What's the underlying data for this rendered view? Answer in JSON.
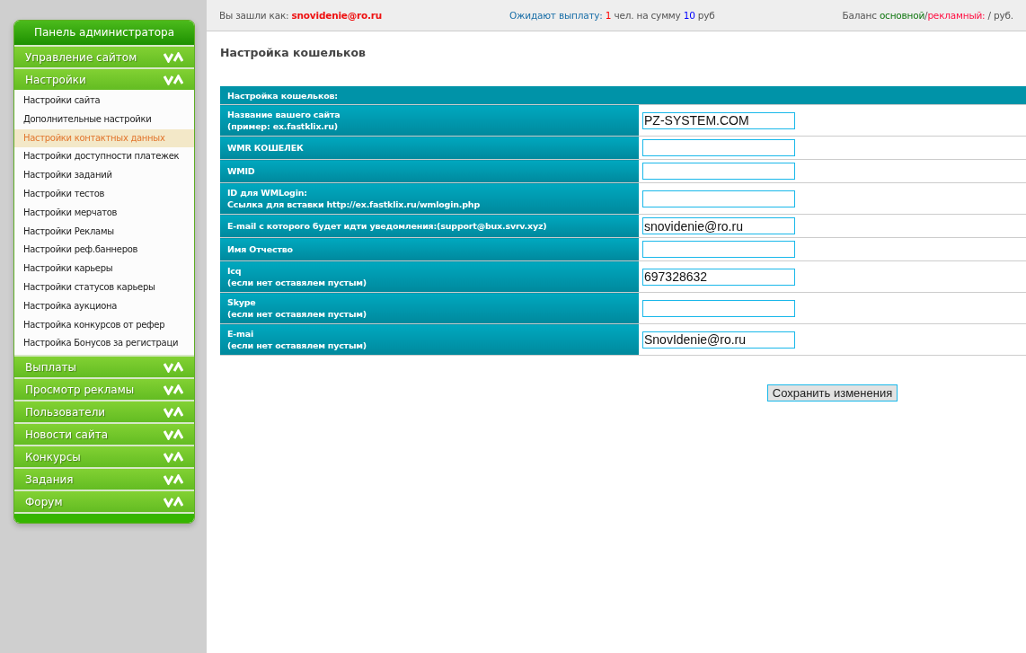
{
  "top_bar": {
    "login": {
      "label": "Вы зашли как:",
      "user": "snovidenie@ro.ru"
    },
    "pending": {
      "label": "Ожидают выплату:",
      "count": "1",
      "middle": "чел. на сумму",
      "sum": "10",
      "unit": "руб"
    },
    "balance": {
      "label": "Баланс",
      "main": "основной",
      "sep": "/",
      "ads": "рекламный:",
      "tail": "/ руб."
    }
  },
  "sidebar": {
    "title": "Панель администратора",
    "sections": [
      {
        "label": "Управление сайтом"
      },
      {
        "label": "Настройки",
        "items": [
          {
            "label": "Настройки сайта",
            "selected": false
          },
          {
            "label": "Дополнительные настройки",
            "selected": false
          },
          {
            "label": "Настройки контактных данных",
            "selected": true
          },
          {
            "label": "Настройки доступности платежек",
            "selected": false
          },
          {
            "label": "Настройки заданий",
            "selected": false
          },
          {
            "label": "Настройки тестов",
            "selected": false
          },
          {
            "label": "Настройки мерчатов",
            "selected": false
          },
          {
            "label": "Настройки Рекламы",
            "selected": false
          },
          {
            "label": "Настройки реф.баннеров",
            "selected": false
          },
          {
            "label": "Настройки карьеры",
            "selected": false
          },
          {
            "label": "Настройки статусов карьеры",
            "selected": false
          },
          {
            "label": "Настройка аукциона",
            "selected": false
          },
          {
            "label": "Настройка конкурсов от рефер",
            "selected": false
          },
          {
            "label": "Настройка Бонусов за регистраци",
            "selected": false
          }
        ]
      },
      {
        "label": "Выплаты"
      },
      {
        "label": "Просмотр рекламы"
      },
      {
        "label": "Пользователи"
      },
      {
        "label": "Новости сайта"
      },
      {
        "label": "Конкурсы"
      },
      {
        "label": "Задания"
      },
      {
        "label": "Форум"
      }
    ]
  },
  "page_title": "Настройка кошельков",
  "form": {
    "header": "Настройка кошельков:",
    "rows": [
      {
        "lines": [
          "Название вашего сайта",
          "(пример: ex.fastklix.ru)"
        ],
        "value": "PZ-SYSTEM.COM"
      },
      {
        "lines": [
          "WMR КОШЕЛЕК"
        ]
      },
      {
        "lines": [
          "WMID"
        ]
      },
      {
        "lines": [
          "ID для WMLogin:",
          "Ссылка для вставки http://ex.fastklix.ru/wmlogin.php"
        ]
      },
      {
        "lines": [
          "E-mail с которого будет идти уведомления:(support@bux.svrv.xyz)"
        ],
        "value": "snovidenie@ro.ru"
      },
      {
        "lines": [
          "Имя Отчество"
        ]
      },
      {
        "lines": [
          "Icq",
          "(если нет оставялем пустым)"
        ],
        "value": "697328632"
      },
      {
        "lines": [
          "Skype",
          "(если нет оставялем пустым)"
        ]
      },
      {
        "lines": [
          "E-mai",
          "(если нет оставялем пустым)"
        ],
        "value": "SnovIdenie@ro.ru"
      }
    ],
    "submit": "Сохранить изменения"
  }
}
